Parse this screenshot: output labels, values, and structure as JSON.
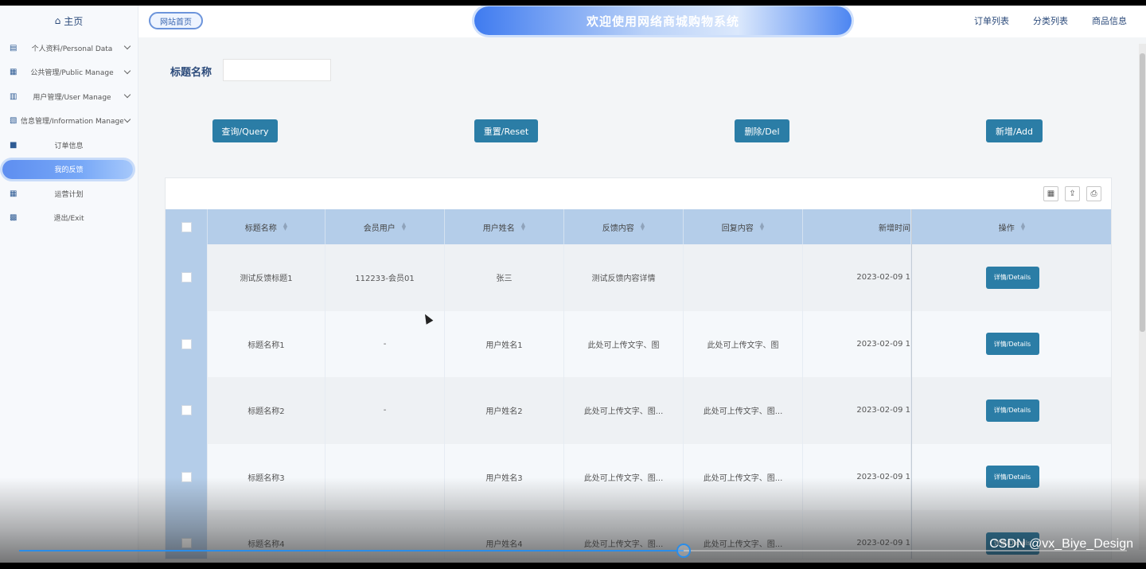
{
  "sidebar": {
    "home": "主页",
    "items": [
      {
        "label": "个人资料/Personal Data",
        "icon": "document-icon",
        "chevron": true
      },
      {
        "label": "公共管理/Public Manage",
        "icon": "file-icon",
        "chevron": true
      },
      {
        "label": "用户管理/User Manage",
        "icon": "bar-chart-icon",
        "chevron": true
      },
      {
        "label": "信息管理/Information Manage",
        "icon": "analytics-icon",
        "chevron": true
      },
      {
        "label": "订单信息",
        "icon": "bookmark-icon",
        "chevron": false
      },
      {
        "label": "我的反馈",
        "icon": "",
        "chevron": false,
        "active": true
      },
      {
        "label": "运营计划",
        "icon": "calendar-icon",
        "chevron": false
      },
      {
        "label": "退出/Exit",
        "icon": "calendar-check-icon",
        "chevron": false
      }
    ]
  },
  "header": {
    "home_button": "网站首页",
    "banner_title": "欢迎使用网络商城购物系统",
    "links": [
      "订单列表",
      "分类列表",
      "商品信息"
    ]
  },
  "search": {
    "label": "标题名称",
    "value": ""
  },
  "buttons": {
    "query": "查询/Query",
    "reset": "重置/Reset",
    "delete": "删除/Del",
    "add": "新增/Add"
  },
  "table": {
    "columns": [
      "标题名称",
      "会员用户",
      "用户姓名",
      "反馈内容",
      "回复内容",
      "新增时间",
      "操作"
    ],
    "rows": [
      {
        "title": "测试反馈标题1",
        "member": "112233-会员01",
        "name": "张三",
        "feedback": "测试反馈内容详情",
        "reply": "",
        "time": "2023-02-09 1",
        "action": "详情/Details"
      },
      {
        "title": "标题名称1",
        "member": "-",
        "name": "用户姓名1",
        "feedback": "此处可上传文字、图",
        "reply": "此处可上传文字、图",
        "time": "2023-02-09 1",
        "action": "详情/Details"
      },
      {
        "title": "标题名称2",
        "member": "-",
        "name": "用户姓名2",
        "feedback": "此处可上传文字、图...",
        "reply": "此处可上传文字、图...",
        "time": "2023-02-09 1",
        "action": "详情/Details"
      },
      {
        "title": "标题名称3",
        "member": "",
        "name": "用户姓名3",
        "feedback": "此处可上传文字、图...",
        "reply": "此处可上传文字、图...",
        "time": "2023-02-09 1",
        "action": "详情/Details"
      },
      {
        "title": "标题名称4",
        "member": "",
        "name": "用户姓名4",
        "feedback": "此处可上传文字、图...",
        "reply": "此处可上传文字、图...",
        "time": "2023-02-09 1",
        "action": "详情/Details"
      }
    ]
  },
  "video": {
    "progress": 0.6,
    "watermark": "CSDN @vx_Biye_Design"
  },
  "colors": {
    "accent": "#2b7da6",
    "header_row": "#b4cde9",
    "active_menu": "#6e9ff5"
  }
}
